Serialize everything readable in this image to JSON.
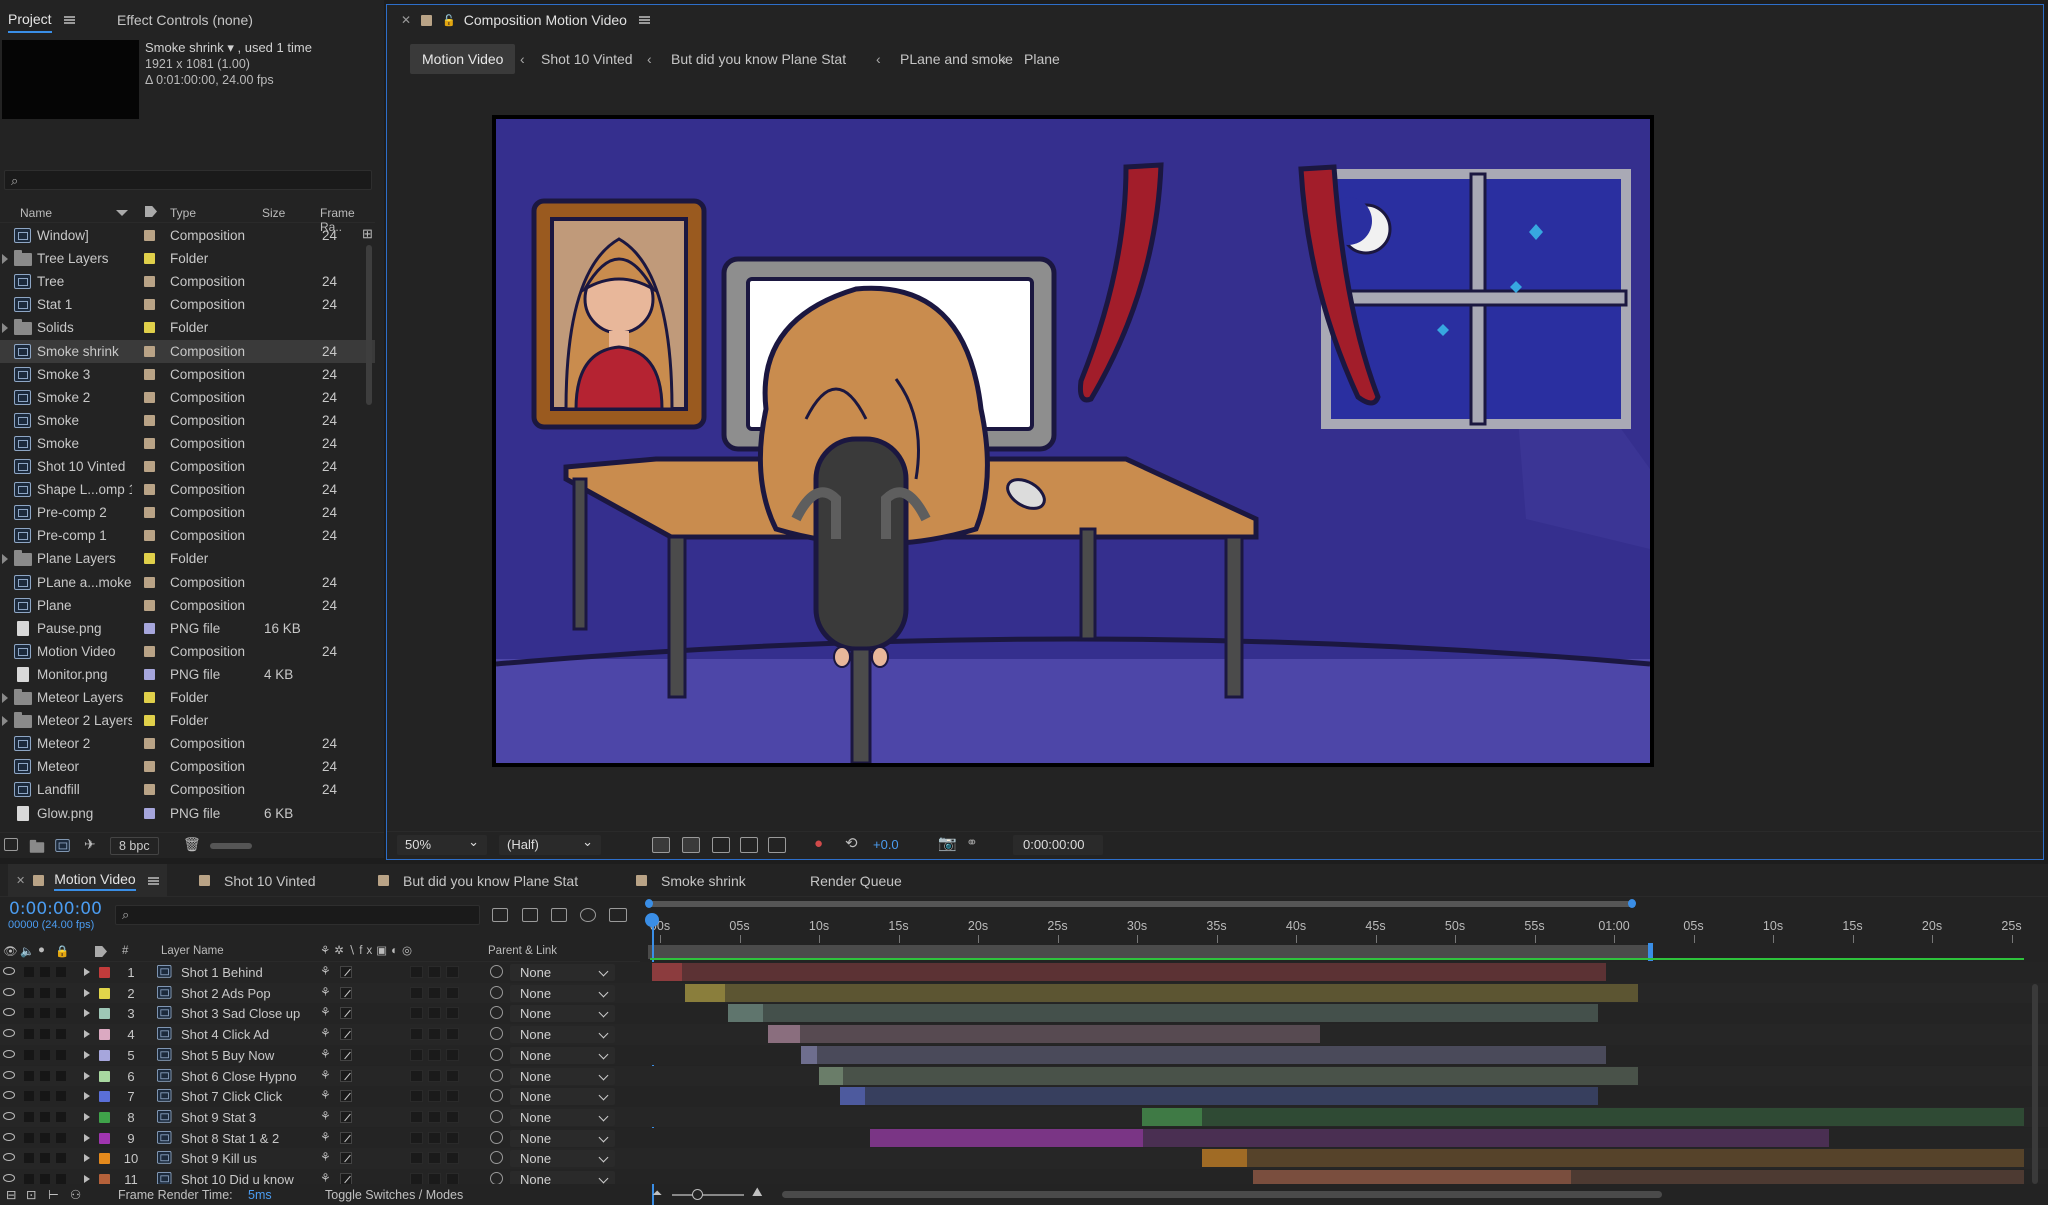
{
  "project_panel": {
    "tab_project": "Project",
    "tab_effect_controls": "Effect Controls (none)",
    "selected_name": "Smoke shrink ▾ , used 1 time",
    "selected_dims": "1921 x 1081 (1.00)",
    "selected_duration": "Δ 0:01:00:00, 24.00 fps",
    "search_placeholder": "",
    "columns": {
      "name": "Name",
      "type": "Type",
      "size": "Size",
      "frame_rate": "Frame Ra.."
    },
    "rows": [
      {
        "name": "Window]",
        "type": "Composition",
        "size": "",
        "fr": "24",
        "kind": "comp",
        "label": "#b9a386",
        "twirl": false
      },
      {
        "name": "Tree Layers",
        "type": "Folder",
        "size": "",
        "fr": "",
        "kind": "folder",
        "label": "#e0d04a",
        "twirl": true
      },
      {
        "name": "Tree",
        "type": "Composition",
        "size": "",
        "fr": "24",
        "kind": "comp",
        "label": "#b9a386",
        "twirl": false
      },
      {
        "name": "Stat 1",
        "type": "Composition",
        "size": "",
        "fr": "24",
        "kind": "comp",
        "label": "#b9a386",
        "twirl": false
      },
      {
        "name": "Solids",
        "type": "Folder",
        "size": "",
        "fr": "",
        "kind": "folder",
        "label": "#e0d04a",
        "twirl": true
      },
      {
        "name": "Smoke shrink",
        "type": "Composition",
        "size": "",
        "fr": "24",
        "kind": "comp",
        "label": "#b9a386",
        "twirl": false,
        "selected": true
      },
      {
        "name": "Smoke 3",
        "type": "Composition",
        "size": "",
        "fr": "24",
        "kind": "comp",
        "label": "#b9a386",
        "twirl": false
      },
      {
        "name": "Smoke 2",
        "type": "Composition",
        "size": "",
        "fr": "24",
        "kind": "comp",
        "label": "#b9a386",
        "twirl": false
      },
      {
        "name": "Smoke",
        "type": "Composition",
        "size": "",
        "fr": "24",
        "kind": "comp",
        "label": "#b9a386",
        "twirl": false
      },
      {
        "name": "Smoke",
        "type": "Composition",
        "size": "",
        "fr": "24",
        "kind": "comp",
        "label": "#b9a386",
        "twirl": false
      },
      {
        "name": "Shot 10 Vinted",
        "type": "Composition",
        "size": "",
        "fr": "24",
        "kind": "comp",
        "label": "#b9a386",
        "twirl": false
      },
      {
        "name": "Shape L...omp 1",
        "type": "Composition",
        "size": "",
        "fr": "24",
        "kind": "comp",
        "label": "#b9a386",
        "twirl": false
      },
      {
        "name": "Pre-comp 2",
        "type": "Composition",
        "size": "",
        "fr": "24",
        "kind": "comp",
        "label": "#b9a386",
        "twirl": false
      },
      {
        "name": "Pre-comp 1",
        "type": "Composition",
        "size": "",
        "fr": "24",
        "kind": "comp",
        "label": "#b9a386",
        "twirl": false
      },
      {
        "name": "Plane Layers",
        "type": "Folder",
        "size": "",
        "fr": "",
        "kind": "folder",
        "label": "#e0d04a",
        "twirl": true
      },
      {
        "name": "PLane a...moke",
        "type": "Composition",
        "size": "",
        "fr": "24",
        "kind": "comp",
        "label": "#b9a386",
        "twirl": false
      },
      {
        "name": "Plane",
        "type": "Composition",
        "size": "",
        "fr": "24",
        "kind": "comp",
        "label": "#b9a386",
        "twirl": false
      },
      {
        "name": "Pause.png",
        "type": "PNG file",
        "size": "16 KB",
        "fr": "",
        "kind": "file",
        "label": "#a6a6dc",
        "twirl": false
      },
      {
        "name": "Motion Video",
        "type": "Composition",
        "size": "",
        "fr": "24",
        "kind": "comp",
        "label": "#b9a386",
        "twirl": false
      },
      {
        "name": "Monitor.png",
        "type": "PNG file",
        "size": "4 KB",
        "fr": "",
        "kind": "file",
        "label": "#a6a6dc",
        "twirl": false
      },
      {
        "name": "Meteor Layers",
        "type": "Folder",
        "size": "",
        "fr": "",
        "kind": "folder",
        "label": "#e0d04a",
        "twirl": true
      },
      {
        "name": "Meteor 2 Layers",
        "type": "Folder",
        "size": "",
        "fr": "",
        "kind": "folder",
        "label": "#e0d04a",
        "twirl": true
      },
      {
        "name": "Meteor 2",
        "type": "Composition",
        "size": "",
        "fr": "24",
        "kind": "comp",
        "label": "#b9a386",
        "twirl": false
      },
      {
        "name": "Meteor",
        "type": "Composition",
        "size": "",
        "fr": "24",
        "kind": "comp",
        "label": "#b9a386",
        "twirl": false
      },
      {
        "name": "Landfill",
        "type": "Composition",
        "size": "",
        "fr": "24",
        "kind": "comp",
        "label": "#b9a386",
        "twirl": false
      },
      {
        "name": "Glow.png",
        "type": "PNG file",
        "size": "6 KB",
        "fr": "",
        "kind": "file",
        "label": "#a6a6dc",
        "twirl": false
      }
    ],
    "bpc": "8 bpc"
  },
  "composition_panel": {
    "title": "Composition Motion Video",
    "breadcrumbs": [
      "Motion Video",
      "Shot 10 Vinted",
      "But did you know Plane Stat",
      "PLane and smoke",
      "Plane"
    ],
    "zoom": "50%",
    "resolution": "(Half)",
    "exposure": "+0.0",
    "timecode": "0:00:00:00"
  },
  "timeline_panel": {
    "tabs": [
      "Motion Video",
      "Shot 10 Vinted",
      "But did you know Plane Stat",
      "Smoke shrink",
      "Render Queue"
    ],
    "current_time": "0:00:00:00",
    "current_frames": "00000 (24.00 fps)",
    "columns": {
      "num": "#",
      "layer_name": "Layer Name",
      "parent": "Parent & Link"
    },
    "ruler_labels": [
      "00s",
      "05s",
      "10s",
      "15s",
      "20s",
      "25s",
      "30s",
      "35s",
      "40s",
      "45s",
      "50s",
      "55s",
      "01:00",
      "05s",
      "10s",
      "15s",
      "20s",
      "25s"
    ],
    "layers": [
      {
        "num": "1",
        "name": "Shot 1 Behind",
        "label": "#c23b3b",
        "parent": "None",
        "start": 0,
        "end": 60,
        "bar": "#5c3234",
        "head": "#8c3c3e",
        "head_len": 1.9
      },
      {
        "num": "2",
        "name": "Shot 2 Ads Pop",
        "label": "#e1d54a",
        "parent": "None",
        "start": 2.1,
        "end": 62,
        "bar": "#5c5532",
        "head": "#8a7e3c",
        "head_len": 2.5
      },
      {
        "num": "3",
        "name": "Shot 3 Sad Close up",
        "label": "#9ec7b6",
        "parent": "None",
        "start": 4.8,
        "end": 59.5,
        "bar": "#44504b",
        "head": "#5f756d",
        "head_len": 2.2
      },
      {
        "num": "4",
        "name": "Shot 4 Click Ad",
        "label": "#dba9c1",
        "parent": "None",
        "start": 7.3,
        "end": 42,
        "bar": "#574a51",
        "head": "#8a6e7e",
        "head_len": 2
      },
      {
        "num": "5",
        "name": "Shot 5 Buy Now",
        "label": "#a6a6dc",
        "parent": "None",
        "start": 9.4,
        "end": 60,
        "bar": "#4a4a5a",
        "head": "#6e6e8e",
        "head_len": 1
      },
      {
        "num": "6",
        "name": "Shot 6 Close Hypno",
        "label": "#a8d8a0",
        "parent": "None",
        "start": 10.5,
        "end": 62,
        "bar": "#495249",
        "head": "#6a7d69",
        "head_len": 1.5
      },
      {
        "num": "7",
        "name": "Shot 7 Click Click",
        "label": "#5a6fd8",
        "parent": "None",
        "start": 11.8,
        "end": 59.5,
        "bar": "#373f5e",
        "head": "#4d5a9e",
        "head_len": 1.6
      },
      {
        "num": "8",
        "name": "Shot 9 Stat 3",
        "label": "#3fa34a",
        "parent": "None",
        "start": 30.8,
        "end": 86.5,
        "bar": "#2f4a34",
        "head": "#3f7a45",
        "head_len": 3.8
      },
      {
        "num": "9",
        "name": "Shot 8 Stat 1 & 2",
        "label": "#a035b0",
        "parent": "None",
        "start": 13.7,
        "end": 74,
        "bar": "#4a2f52",
        "head": "#7a3585",
        "head_len": 17.2
      },
      {
        "num": "10",
        "name": "Shot 9 Kill us",
        "label": "#e58a1c",
        "parent": "None",
        "start": 34.6,
        "end": 86.5,
        "bar": "#56432a",
        "head": "#a06b25",
        "head_len": 2.8
      },
      {
        "num": "11",
        "name": "Shot 10 Did u know",
        "label": "#b5613a",
        "parent": "None",
        "start": 37.8,
        "end": 86.5,
        "bar": "#4d3a32",
        "head": "#7a4e3e",
        "head_len": 20
      }
    ],
    "footer_render_label": "Frame Render Time:",
    "footer_render_value": "5ms",
    "footer_toggle": "Toggle Switches / Modes"
  }
}
